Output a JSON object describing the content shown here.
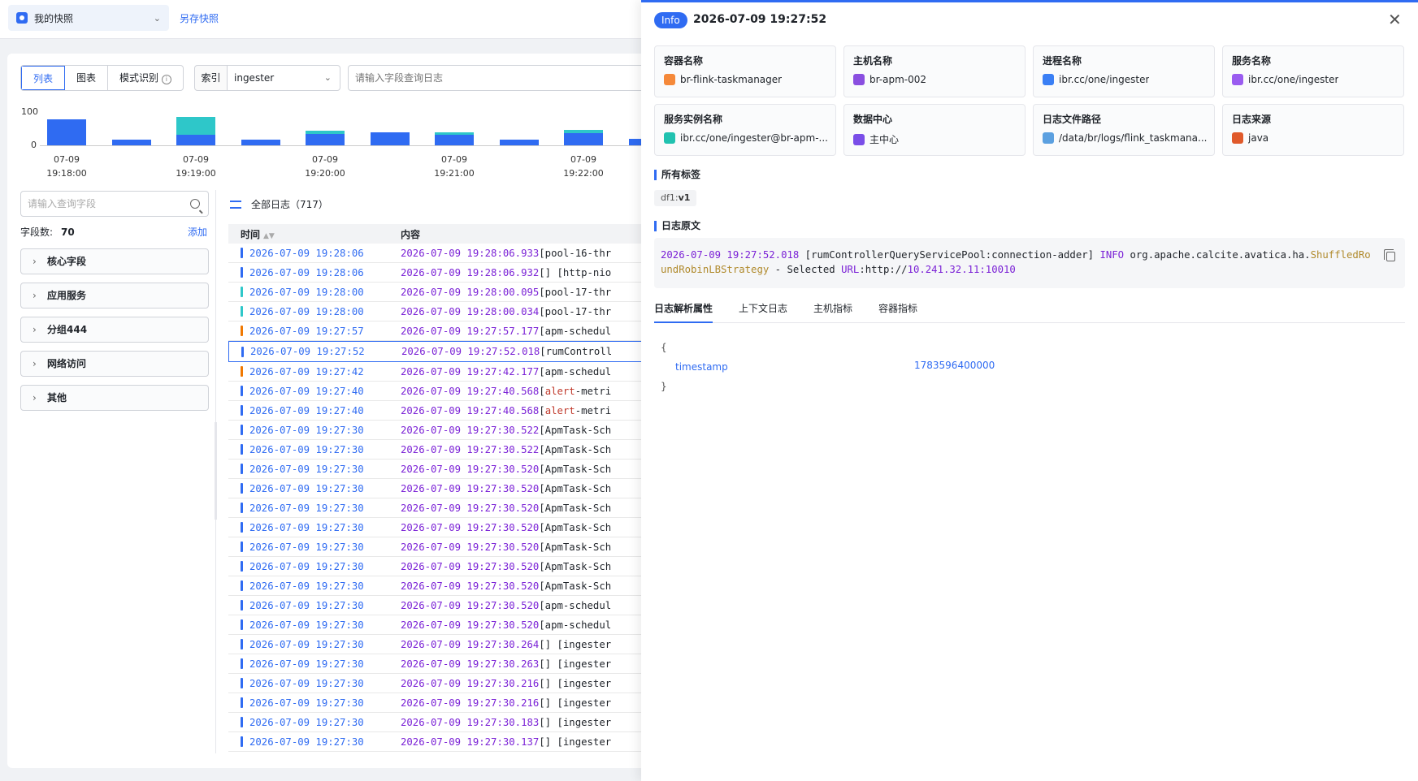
{
  "topbar": {
    "snapshot_label": "我的快照",
    "save_snapshot": "另存快照"
  },
  "toolbar": {
    "tabs": [
      "列表",
      "图表",
      "模式识别"
    ],
    "index_label": "索引",
    "index_value": "ingester",
    "query_placeholder": "请输入字段查询日志"
  },
  "chart_data": {
    "type": "bar",
    "ylim": [
      0,
      100
    ],
    "yticks": [
      "100",
      "0"
    ],
    "xticks": [
      [
        "07-09",
        "19:18:00"
      ],
      [
        "07-09",
        "19:19:00"
      ],
      [
        "07-09",
        "19:20:00"
      ],
      [
        "07-09",
        "19:21:00"
      ],
      [
        "07-09",
        "19:22:00"
      ]
    ],
    "series": [
      {
        "color": "#2f6bf2",
        "values": [
          72,
          16,
          28,
          16,
          32,
          36,
          28,
          16,
          34,
          18
        ]
      },
      {
        "color": "#2ec7c9",
        "values": [
          0,
          0,
          50,
          0,
          8,
          0,
          8,
          0,
          8,
          0
        ]
      }
    ]
  },
  "fields": {
    "search_placeholder": "请输入查询字段",
    "count_label": "字段数:",
    "count_value": "70",
    "add_label": "添加",
    "groups": [
      "核心字段",
      "应用服务",
      "分组444",
      "网络访问",
      "其他"
    ]
  },
  "logs": {
    "title": "全部日志（717）",
    "col_time": "时间",
    "col_content": "内容",
    "rows": [
      {
        "time": "2026-07-09 19:28:06",
        "content_ts": "2026-07-09 19:28:06.933",
        "rest": " [pool-16-thr",
        "color": "#2f6bf2"
      },
      {
        "time": "2026-07-09 19:28:06",
        "content_ts": "2026-07-09 19:28:06.932",
        "rest": " [] [http-nio",
        "color": "#2f6bf2"
      },
      {
        "time": "2026-07-09 19:28:00",
        "content_ts": "2026-07-09 19:28:00.095",
        "rest": " [pool-17-thr",
        "color": "#2ec7c9"
      },
      {
        "time": "2026-07-09 19:28:00",
        "content_ts": "2026-07-09 19:28:00.034",
        "rest": " [pool-17-thr",
        "color": "#2ec7c9"
      },
      {
        "time": "2026-07-09 19:27:57",
        "content_ts": "2026-07-09 19:27:57.177",
        "rest": " [apm-schedul",
        "color": "#f07800"
      },
      {
        "time": "2026-07-09 19:27:52",
        "content_ts": "2026-07-09 19:27:52.018",
        "rest": " [rumControll",
        "color": "#2f6bf2"
      },
      {
        "time": "2026-07-09 19:27:42",
        "content_ts": "2026-07-09 19:27:42.177",
        "rest": " [apm-schedul",
        "color": "#f07800"
      },
      {
        "time": "2026-07-09 19:27:40",
        "content_ts": "2026-07-09 19:27:40.568",
        "rest": " [alert-metri",
        "color": "#2f6bf2"
      },
      {
        "time": "2026-07-09 19:27:40",
        "content_ts": "2026-07-09 19:27:40.568",
        "rest": " [alert-metri",
        "color": "#2f6bf2"
      },
      {
        "time": "2026-07-09 19:27:30",
        "content_ts": "2026-07-09 19:27:30.522",
        "rest": " [ApmTask-Sch",
        "color": "#2f6bf2"
      },
      {
        "time": "2026-07-09 19:27:30",
        "content_ts": "2026-07-09 19:27:30.522",
        "rest": " [ApmTask-Sch",
        "color": "#2f6bf2"
      },
      {
        "time": "2026-07-09 19:27:30",
        "content_ts": "2026-07-09 19:27:30.520",
        "rest": " [ApmTask-Sch",
        "color": "#2f6bf2"
      },
      {
        "time": "2026-07-09 19:27:30",
        "content_ts": "2026-07-09 19:27:30.520",
        "rest": " [ApmTask-Sch",
        "color": "#2f6bf2"
      },
      {
        "time": "2026-07-09 19:27:30",
        "content_ts": "2026-07-09 19:27:30.520",
        "rest": " [ApmTask-Sch",
        "color": "#2f6bf2"
      },
      {
        "time": "2026-07-09 19:27:30",
        "content_ts": "2026-07-09 19:27:30.520",
        "rest": " [ApmTask-Sch",
        "color": "#2f6bf2"
      },
      {
        "time": "2026-07-09 19:27:30",
        "content_ts": "2026-07-09 19:27:30.520",
        "rest": " [ApmTask-Sch",
        "color": "#2f6bf2"
      },
      {
        "time": "2026-07-09 19:27:30",
        "content_ts": "2026-07-09 19:27:30.520",
        "rest": " [ApmTask-Sch",
        "color": "#2f6bf2"
      },
      {
        "time": "2026-07-09 19:27:30",
        "content_ts": "2026-07-09 19:27:30.520",
        "rest": " [ApmTask-Sch",
        "color": "#2f6bf2"
      },
      {
        "time": "2026-07-09 19:27:30",
        "content_ts": "2026-07-09 19:27:30.520",
        "rest": " [apm-schedul",
        "color": "#2f6bf2"
      },
      {
        "time": "2026-07-09 19:27:30",
        "content_ts": "2026-07-09 19:27:30.520",
        "rest": " [apm-schedul",
        "color": "#2f6bf2"
      },
      {
        "time": "2026-07-09 19:27:30",
        "content_ts": "2026-07-09 19:27:30.264",
        "rest": " [] [ingester",
        "color": "#2f6bf2"
      },
      {
        "time": "2026-07-09 19:27:30",
        "content_ts": "2026-07-09 19:27:30.263",
        "rest": " [] [ingester",
        "color": "#2f6bf2"
      },
      {
        "time": "2026-07-09 19:27:30",
        "content_ts": "2026-07-09 19:27:30.216",
        "rest": " [] [ingester",
        "color": "#2f6bf2"
      },
      {
        "time": "2026-07-09 19:27:30",
        "content_ts": "2026-07-09 19:27:30.216",
        "rest": " [] [ingester",
        "color": "#2f6bf2"
      },
      {
        "time": "2026-07-09 19:27:30",
        "content_ts": "2026-07-09 19:27:30.183",
        "rest": " [] [ingester",
        "color": "#2f6bf2"
      },
      {
        "time": "2026-07-09 19:27:30",
        "content_ts": "2026-07-09 19:27:30.137",
        "rest": " [] [ingester",
        "color": "#2f6bf2"
      }
    ]
  },
  "detail": {
    "level": "Info",
    "title": "2026-07-09 19:27:52",
    "cards": [
      {
        "key": "容器名称",
        "value": "br-flink-taskmanager",
        "icon": "container-icon",
        "color": "#f5893a"
      },
      {
        "key": "主机名称",
        "value": "br-apm-002",
        "icon": "host-icon",
        "color": "#8a4fe0"
      },
      {
        "key": "进程名称",
        "value": "ibr.cc/one/ingester",
        "icon": "process-icon",
        "color": "#3a7ff5"
      },
      {
        "key": "服务名称",
        "value": "ibr.cc/one/ingester",
        "icon": "service-icon",
        "color": "#9a5cf0"
      },
      {
        "key": "服务实例名称",
        "value": "ibr.cc/one/ingester@br-apm-...",
        "icon": "instance-icon",
        "color": "#21c2b0"
      },
      {
        "key": "数据中心",
        "value": "主中心",
        "icon": "datacenter-icon",
        "color": "#7a4ee8"
      },
      {
        "key": "日志文件路径",
        "value": "/data/br/logs/flink_taskmana...",
        "icon": "file-path-icon",
        "color": "#5ba0e0"
      },
      {
        "key": "日志来源",
        "value": "java",
        "icon": "java-icon",
        "color": "#e05a2b"
      }
    ],
    "tags_title": "所有标签",
    "tag_key": "df1",
    "tag_value": "v1",
    "raw_title": "日志原文",
    "raw": {
      "ts": "2026-07-09 19:27:52.018",
      "thread": " [rumControllerQueryServicePool:connection-adder] ",
      "level": "INFO",
      "class_a": "  org.apache.calcite.avatica.ha.",
      "class_b": "ShuffledRoundRobinLBStrategy",
      "msg": "  - Selected ",
      "url_label": "URL",
      "url_rest": ":http://",
      "ip": "10.241.32.11:10010"
    },
    "tabs": [
      "日志解析属性",
      "上下文日志",
      "主机指标",
      "容器指标"
    ],
    "json": {
      "open": "{",
      "key": "timestamp",
      "value": "1783596400000",
      "close": "}"
    }
  }
}
